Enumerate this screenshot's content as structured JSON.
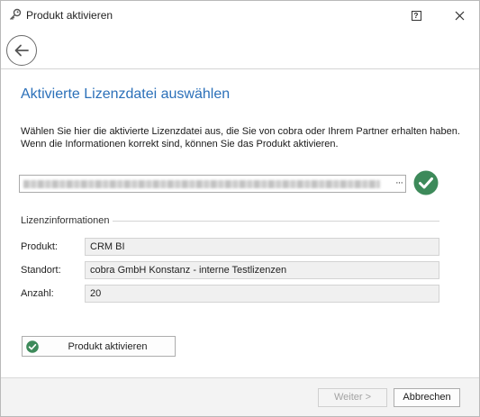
{
  "window": {
    "title": "Produkt aktivieren"
  },
  "titlebar": {
    "help_label": "?",
    "close_glyph": "✕"
  },
  "toolbar": {
    "back_icon": "arrow-left-icon"
  },
  "page": {
    "heading": "Aktivierte Lizenzdatei auswählen",
    "description": "Wählen Sie hier die aktivierte Lizenzdatei aus, die Sie von cobra oder Ihrem Partner erhalten haben. Wenn die Informationen korrekt sind, können Sie das Produkt aktivieren."
  },
  "file": {
    "browse_label": "···",
    "status_icon": "check-circle-icon",
    "status_color": "#3d8a5a"
  },
  "license": {
    "group_label": "Lizenzinformationen",
    "rows": [
      {
        "label": "Produkt:",
        "value": "CRM BI"
      },
      {
        "label": "Standort:",
        "value": "cobra GmbH Konstanz - interne Testlizenzen"
      },
      {
        "label": "Anzahl:",
        "value": "20"
      }
    ]
  },
  "actions": {
    "activate_label": "Produkt aktivieren"
  },
  "footer": {
    "next_label": "Weiter >",
    "cancel_label": "Abbrechen"
  },
  "colors": {
    "accent": "#2b70b9",
    "success": "#3d8a5a"
  }
}
